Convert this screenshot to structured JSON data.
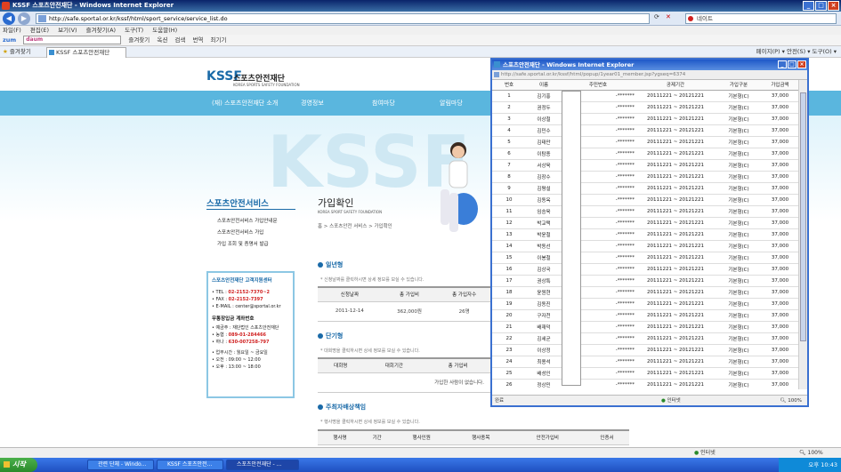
{
  "window": {
    "title": "KSSF 스포츠안전재단 - Windows Internet Explorer"
  },
  "browser": {
    "address": "http://safe.sportal.or.kr/kssf/html/sport_service/service_list.do",
    "search_text": "네이트",
    "menu": [
      "파일(F)",
      "편집(E)",
      "보기(V)",
      "즐겨찾기(A)",
      "도구(T)",
      "도움말(H)"
    ],
    "toolbar": [
      "zum",
      "즐겨찾기",
      "옥션",
      "검색",
      "번역",
      "최기기"
    ],
    "zum_box": "daum",
    "favorites_label": "즐겨찾기",
    "tab_label": "KSSF 스포츠안전재단",
    "right_tools": "페이지(P) ▾   안전(S) ▾   도구(O) ▾"
  },
  "site": {
    "logo": "KSSF",
    "name": "스포츠안전재단",
    "name_sub": "KOREA SPORTS SAFETY FOUNDATION",
    "nav": [
      "(재) 스포츠안전재단 소개",
      "경영정보",
      "참여마당",
      "알림마당"
    ],
    "sidebar_title": "스포츠안전서비스",
    "sidebar_items": [
      "스포츠안전서비스 가입안내문",
      "스포츠안전서비스 가입",
      "가입 조회 및 증명서 발급"
    ],
    "cs": {
      "title": "스포츠안전재단 고객지원센터",
      "tel_label": "• TEL : ",
      "tel": "02-2152-7370~2",
      "fax_label": "• FAX : ",
      "fax": "02-2152-7397",
      "email": "• E-MAIL : center@sportal.or.kr",
      "bank_title": "무통장입금 계좌번호",
      "holder": "• 예금주 : 재단법인 스포츠안전재단",
      "bank1_label": "• 농협 : ",
      "bank1": "089-01-284466",
      "bank2_label": "• 하나 : ",
      "bank2": "630-007258-797",
      "hours": "• 업무시간 : 월요일 ~ 금요일",
      "am": "• 오전 : 09:00 ~ 12:00",
      "pm": "• 오후 : 13:00 ~ 18:00"
    },
    "page_title": "가입확인",
    "page_sub": "KOREA SPORT SAFETY FOUNDATION",
    "breadcrumb": "홈 > 스포츠안전 서비스 > 가입확인",
    "sec1": "일년형",
    "sec1_note": "* 신청날짜를 클릭하시면 상세 정보를 보실 수 있습니다.",
    "sec1_headers": [
      "신청날짜",
      "총 가입비",
      "총 가입자수"
    ],
    "sec1_row": [
      "2011-12-14",
      "362,000원",
      "26명"
    ],
    "sec2": "단기형",
    "sec2_note": "* 대회명을 클릭하시면 상세 정보를 보실 수 있습니다.",
    "sec2_headers": [
      "대회명",
      "대회기간",
      "총 가입비"
    ],
    "sec2_empty": "가입한 사람이 없습니다.",
    "sec3": "주최자배상책임",
    "sec3_note": "* 행사명을 클릭하시면 상세 정보를 보실 수 있습니다.",
    "sec3_headers": [
      "행사명",
      "기간",
      "행사인원",
      "행사종목",
      "안전가입비",
      "인증서"
    ]
  },
  "popup": {
    "title": "스포츠안전재단 - Windows Internet Explorer",
    "address": "http://safe.sportal.or.kr/kssf/html/popup/1year01_member.jsp?ygseq=6374",
    "headers": [
      "번호",
      "이름",
      "주민번호",
      "공제기간",
      "가입구분",
      "가입금액"
    ],
    "rows": [
      [
        "1",
        "김기홍",
        "-*******",
        "20111221 ~ 20121221",
        "기본형(C)",
        "37,000"
      ],
      [
        "2",
        "권정두",
        "-*******",
        "20111221 ~ 20121221",
        "기본형(C)",
        "37,000"
      ],
      [
        "3",
        "이상철",
        "-*******",
        "20111221 ~ 20121221",
        "기본형(C)",
        "37,000"
      ],
      [
        "4",
        "김민수",
        "-*******",
        "20111221 ~ 20121221",
        "기본형(C)",
        "37,000"
      ],
      [
        "5",
        "김태만",
        "-*******",
        "20111221 ~ 20121221",
        "기본형(C)",
        "37,000"
      ],
      [
        "6",
        "이탐종",
        "-*******",
        "20111221 ~ 20121221",
        "기본형(C)",
        "37,000"
      ],
      [
        "7",
        "서상욱",
        "-*******",
        "20111221 ~ 20121221",
        "기본형(C)",
        "37,000"
      ],
      [
        "8",
        "김장수",
        "-*******",
        "20111221 ~ 20121221",
        "기본형(C)",
        "37,000"
      ],
      [
        "9",
        "김평설",
        "-*******",
        "20111221 ~ 20121221",
        "기본형(C)",
        "37,000"
      ],
      [
        "10",
        "김동옥",
        "-*******",
        "20111221 ~ 20121221",
        "기본형(C)",
        "37,000"
      ],
      [
        "11",
        "임승욱",
        "-*******",
        "20111221 ~ 20121221",
        "기본형(C)",
        "37,000"
      ],
      [
        "12",
        "박교택",
        "-*******",
        "20111221 ~ 20121221",
        "기본형(C)",
        "37,000"
      ],
      [
        "13",
        "박윤철",
        "-*******",
        "20111221 ~ 20121221",
        "기본형(C)",
        "37,000"
      ],
      [
        "14",
        "박동선",
        "-*******",
        "20111221 ~ 20121221",
        "기본형(C)",
        "37,000"
      ],
      [
        "15",
        "이봉철",
        "-*******",
        "20111221 ~ 20121221",
        "기본형(C)",
        "37,000"
      ],
      [
        "16",
        "김상국",
        "-*******",
        "20111221 ~ 20121221",
        "기본형(C)",
        "37,000"
      ],
      [
        "17",
        "권상특",
        "-*******",
        "20111221 ~ 20121221",
        "기본형(C)",
        "37,000"
      ],
      [
        "18",
        "윤원현",
        "-*******",
        "20111221 ~ 20121221",
        "기본형(C)",
        "37,000"
      ],
      [
        "19",
        "김동진",
        "-*******",
        "20111221 ~ 20121221",
        "기본형(C)",
        "37,000"
      ],
      [
        "20",
        "구자천",
        "-*******",
        "20111221 ~ 20121221",
        "기본형(C)",
        "37,000"
      ],
      [
        "21",
        "배재덕",
        "-*******",
        "20111221 ~ 20121221",
        "기본형(C)",
        "37,000"
      ],
      [
        "22",
        "김세균",
        "-*******",
        "20111221 ~ 20121221",
        "기본형(C)",
        "37,000"
      ],
      [
        "23",
        "이상정",
        "-*******",
        "20111221 ~ 20121221",
        "기본형(C)",
        "37,000"
      ],
      [
        "24",
        "최용석",
        "-*******",
        "20111221 ~ 20121221",
        "기본형(C)",
        "37,000"
      ],
      [
        "25",
        "배성인",
        "-*******",
        "20111221 ~ 20121221",
        "기본형(C)",
        "37,000"
      ],
      [
        "26",
        "정상민",
        "-*******",
        "20111221 ~ 20121221",
        "기본형(C)",
        "37,000"
      ]
    ],
    "status_left": "완료",
    "status_zone": "인터넷",
    "status_zoom": "100%"
  },
  "statusbar": {
    "zone": "인터넷",
    "zoom": "100%"
  },
  "taskbar": {
    "start": "시작",
    "buttons": [
      "관련 단체 - Windo...",
      "KSSF 스포츠안전...",
      "스포츠안전재단 - ..."
    ],
    "clock": "오후 10:43"
  }
}
